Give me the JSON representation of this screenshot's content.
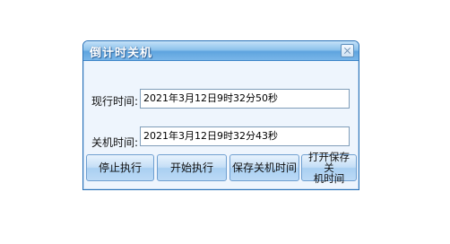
{
  "dialog": {
    "title": "倒计时关机",
    "current_time_label": "现行时间:",
    "current_time_value": "2021年3月12日9时32分50秒",
    "shutdown_time_label": "关机时间:",
    "shutdown_time_value": "2021年3月12日9时32分43秒",
    "buttons": {
      "stop": "停止执行",
      "start": "开始执行",
      "save_time": "保存关机时间",
      "open_saved_line1": "打开保存关",
      "open_saved_line2": "机时间"
    }
  }
}
